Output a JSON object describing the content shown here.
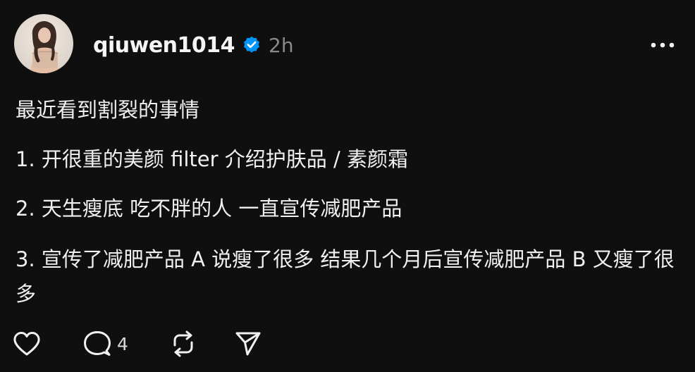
{
  "post": {
    "username": "qiuwen1014",
    "verified": true,
    "timestamp": "2h",
    "paragraphs": [
      "最近看到割裂的事情",
      "1. 开很重的美颜 filter 介绍护肤品 / 素颜霜",
      "2. 天生瘦底 吃不胖的人 一直宣传减肥产品",
      "3. 宣传了减肥产品 A 说瘦了很多 结果几个月后宣传减肥产品 B 又瘦了很多"
    ],
    "actions": {
      "like_icon": "heart-icon",
      "comment_icon": "comment-icon",
      "comment_count": "4",
      "repost_icon": "repost-icon",
      "share_icon": "send-icon"
    },
    "more_icon": "more-horizontal-icon"
  },
  "colors": {
    "background": "#0f0f0f",
    "text": "#f0f0f0",
    "muted": "#8a8a8a",
    "verified_badge": "#0095f6"
  }
}
